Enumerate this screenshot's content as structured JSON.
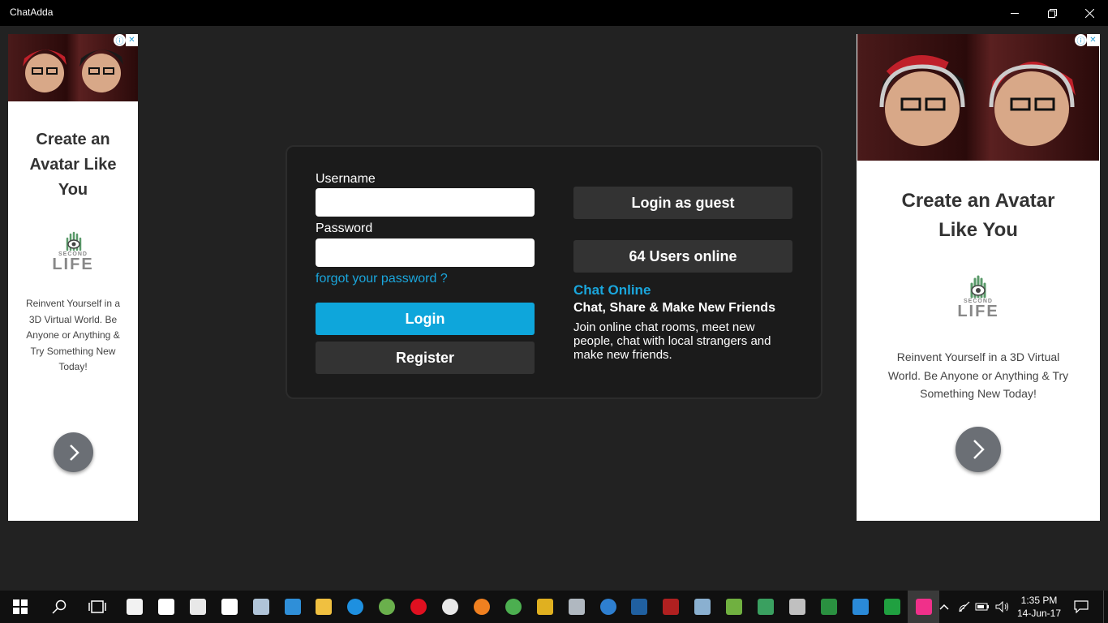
{
  "window": {
    "title": "ChatAdda"
  },
  "ad_left": {
    "headline": "Create an Avatar Like You",
    "logo_small": "SECOND",
    "logo_big": "LIFE",
    "description": "Reinvent Yourself in a 3D Virtual World. Be Anyone or Anything & Try Something New Today!"
  },
  "ad_right": {
    "headline": "Create an Avatar Like You",
    "logo_small": "SECOND",
    "logo_big": "LIFE",
    "description": "Reinvent Yourself in a 3D Virtual World. Be Anyone or Anything & Try Something New Today!"
  },
  "login": {
    "username_label": "Username",
    "username_value": "",
    "password_label": "Password",
    "password_value": "",
    "forgot_link": "forgot your password ?",
    "login_button": "Login",
    "register_button": "Register",
    "guest_button": "Login as guest",
    "users_online": "64 Users online"
  },
  "promo": {
    "title": "Chat Online",
    "subtitle": "Chat, Share & Make New Friends",
    "text": "Join online chat rooms, meet new people, chat with local strangers and make new friends."
  },
  "taskbar": {
    "time": "1:35 PM",
    "date": "14-Jun-17",
    "apps": [
      {
        "name": "store-icon",
        "color": "#f2f2f2"
      },
      {
        "name": "settings-icon",
        "color": "#ffffff"
      },
      {
        "name": "calculator-icon",
        "color": "#e8e8e8"
      },
      {
        "name": "mail-icon",
        "color": "#ffffff"
      },
      {
        "name": "scanner-icon",
        "color": "#b0c4d8"
      },
      {
        "name": "remote-desktop-icon",
        "color": "#2f8fd8"
      },
      {
        "name": "file-explorer-icon",
        "color": "#f0c040"
      },
      {
        "name": "edge-icon",
        "color": "#1e90e0"
      },
      {
        "name": "maps-icon",
        "color": "#6ab04c"
      },
      {
        "name": "opera-icon",
        "color": "#e01020"
      },
      {
        "name": "opera-dev-icon",
        "color": "#e8e8e8"
      },
      {
        "name": "firefox-icon",
        "color": "#f08020"
      },
      {
        "name": "chrome-icon",
        "color": "#4caf50"
      },
      {
        "name": "tool-icon",
        "color": "#e0b020"
      },
      {
        "name": "paint-icon",
        "color": "#b0b8c0"
      },
      {
        "name": "pie-chart-icon",
        "color": "#2e7fd0"
      },
      {
        "name": "dolby-icon",
        "color": "#2060a0"
      },
      {
        "name": "shield-app-icon",
        "color": "#b02020"
      },
      {
        "name": "notes-app-icon",
        "color": "#8ab0d0"
      },
      {
        "name": "spreadsheet-icon",
        "color": "#70b040"
      },
      {
        "name": "chat-app-icon",
        "color": "#3aa060"
      },
      {
        "name": "video-icon",
        "color": "#c0c0c0"
      },
      {
        "name": "code-icon",
        "color": "#2a9040"
      },
      {
        "name": "scissors-icon",
        "color": "#2a8ad8"
      },
      {
        "name": "triangle-app-icon",
        "color": "#20a040"
      },
      {
        "name": "chatadda-app-icon",
        "color": "#f0308a"
      }
    ]
  }
}
